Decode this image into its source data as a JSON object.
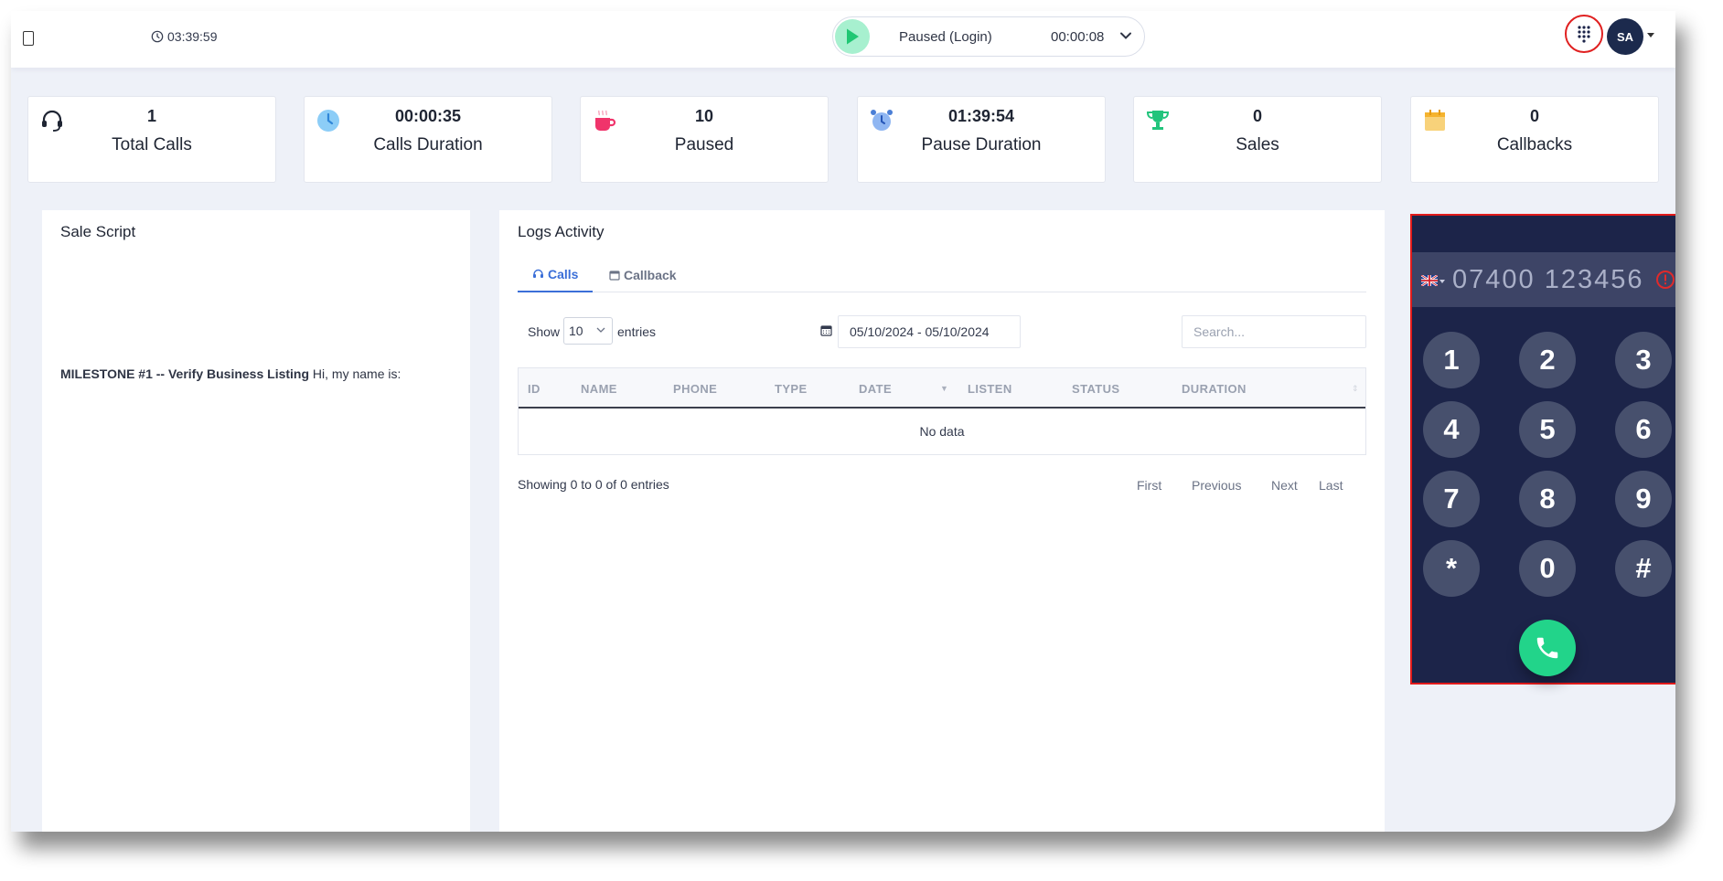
{
  "topbar": {
    "session_timer": "03:39:59",
    "status_label": "Paused (Login)",
    "status_timer": "00:00:08",
    "avatar_initials": "SA"
  },
  "stats": [
    {
      "value": "1",
      "label": "Total Calls",
      "icon": "headset-icon",
      "color": "#1f2533"
    },
    {
      "value": "00:00:35",
      "label": "Calls Duration",
      "icon": "clock-icon",
      "color": "#56b4f2"
    },
    {
      "value": "10",
      "label": "Paused",
      "icon": "coffee-cup-icon",
      "color": "#f0346b"
    },
    {
      "value": "01:39:54",
      "label": "Pause Duration",
      "icon": "alarm-clock-icon",
      "color": "#6aa0ea"
    },
    {
      "value": "0",
      "label": "Sales",
      "icon": "trophy-icon",
      "color": "#22c47c"
    },
    {
      "value": "0",
      "label": "Callbacks",
      "icon": "calendar-icon",
      "color": "#f5c04a"
    }
  ],
  "script_panel": {
    "title": "Sale Script",
    "milestone": "MILESTONE #1 -- Verify Business Listing",
    "text": " Hi, my name is:"
  },
  "logs_panel": {
    "title": "Logs Activity",
    "tabs": [
      {
        "label": "Calls",
        "icon": "headset-icon",
        "active": true
      },
      {
        "label": "Callback",
        "icon": "calendar-icon",
        "active": false
      }
    ],
    "show_label": "Show",
    "entries_selected": "10",
    "entries_label": "entries",
    "date_range": "05/10/2024 - 05/10/2024",
    "search_placeholder": "Search...",
    "columns": [
      "ID",
      "NAME",
      "PHONE",
      "TYPE",
      "DATE",
      "LISTEN",
      "STATUS",
      "DURATION"
    ],
    "empty_text": "No data",
    "showing_text": "Showing 0 to 0 of 0 entries",
    "pagination": [
      "First",
      "Previous",
      "Next",
      "Last"
    ]
  },
  "dialer": {
    "country": "United Kingdom",
    "number": "07400 123456",
    "keys": [
      "1",
      "2",
      "3",
      "4",
      "5",
      "6",
      "7",
      "8",
      "9",
      "*",
      "0",
      "#"
    ],
    "accent": "#22d48a"
  }
}
